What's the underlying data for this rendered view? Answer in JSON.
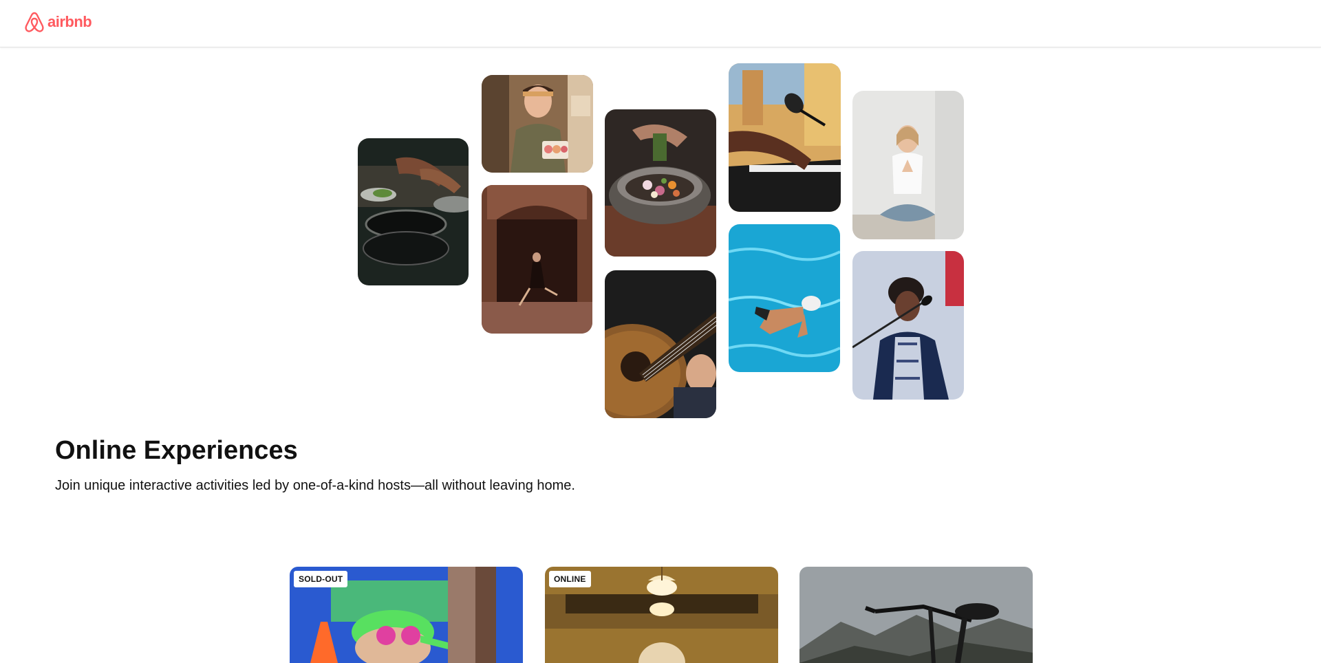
{
  "header": {
    "logo_text": "airbnb",
    "logo_color": "#ff5a5f"
  },
  "hero": {
    "photos": [
      {
        "name": "cooking-pans-photo",
        "icon": "cooking-photo"
      },
      {
        "name": "host-with-macarons-photo",
        "icon": "baker-photo"
      },
      {
        "name": "tango-dancers-photo",
        "icon": "dance-photo"
      },
      {
        "name": "food-bowl-photo",
        "icon": "food-photo"
      },
      {
        "name": "acoustic-guitar-photo",
        "icon": "guitar-photo"
      },
      {
        "name": "piano-microphone-photo",
        "icon": "piano-photo"
      },
      {
        "name": "swimmer-photo",
        "icon": "swim-photo"
      },
      {
        "name": "meditation-photo",
        "icon": "yoga-photo"
      },
      {
        "name": "singer-photo",
        "icon": "singer-photo"
      }
    ]
  },
  "main": {
    "title": "Online Experiences",
    "subtitle": "Join unique interactive activities led by one-of-a-kind hosts—all without leaving home."
  },
  "cards": [
    {
      "badge": "SOLD-OUT",
      "image": "swimmer-with-goggles"
    },
    {
      "badge": "ONLINE",
      "image": "person-under-lamps"
    },
    {
      "badge": "",
      "image": "bicycle-mountains"
    }
  ]
}
